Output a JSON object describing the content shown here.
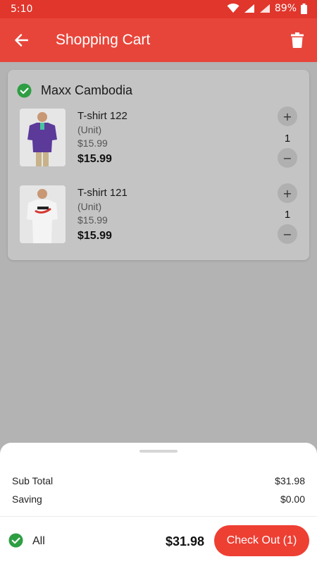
{
  "status_bar": {
    "time": "5:10",
    "battery": "89%"
  },
  "app_bar": {
    "title": "Shopping Cart"
  },
  "store": {
    "name": "Maxx Cambodia"
  },
  "items": [
    {
      "name": "T-shirt 122",
      "unit": "(Unit)",
      "original_price": "$15.99",
      "price": "$15.99",
      "quantity": "1",
      "plus": "+",
      "minus": "−"
    },
    {
      "name": "T-shirt 121",
      "unit": "(Unit)",
      "original_price": "$15.99",
      "price": "$15.99",
      "quantity": "1",
      "plus": "+",
      "minus": "−"
    }
  ],
  "summary": {
    "subtotal_label": "Sub Total",
    "subtotal_value": "$31.98",
    "saving_label": "Saving",
    "saving_value": "$0.00"
  },
  "footer": {
    "all_label": "All",
    "total": "$31.98",
    "checkout_label": "Check Out (1)"
  },
  "colors": {
    "primary": "#e8453a",
    "check_green": "#2e9e43"
  },
  "icons": {
    "back": "arrow-left-icon",
    "delete": "trash-icon",
    "check": "check-circle-icon"
  }
}
